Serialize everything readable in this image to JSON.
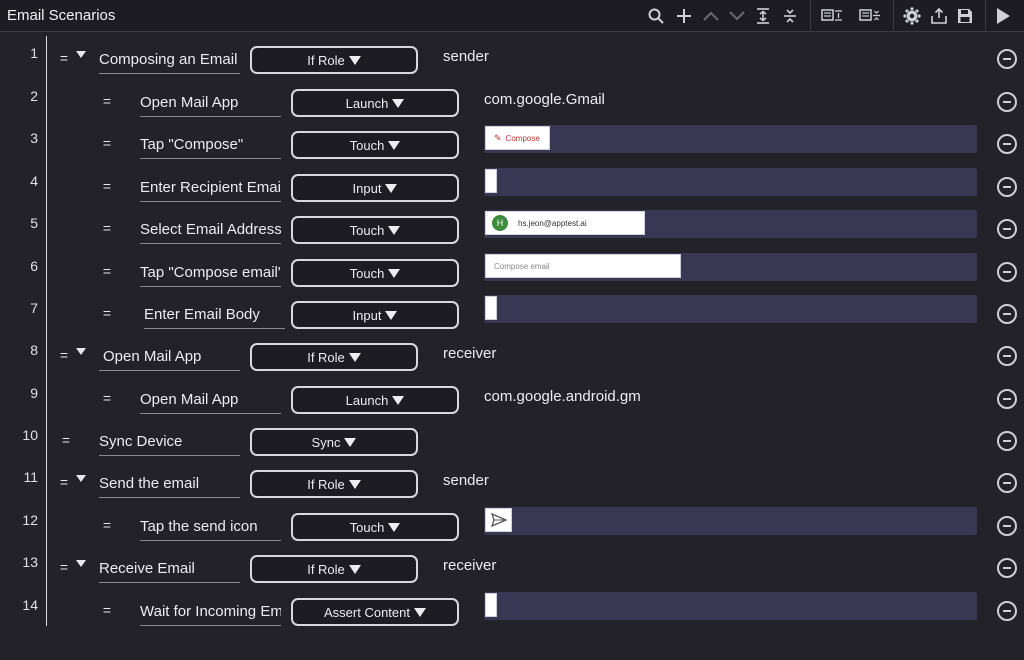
{
  "header": {
    "title": "Email Scenarios",
    "toolbar": [
      "search-icon",
      "add-icon",
      "move-up-icon",
      "move-down-icon",
      "expand-all-icon",
      "collapse-all-icon",
      "expand-text-icon",
      "collapse-text-icon",
      "settings-icon",
      "export-icon",
      "save-icon",
      "run-icon"
    ]
  },
  "steps": [
    {
      "no": "1",
      "name": "Composing an Email",
      "action": "If Role",
      "param": "sender",
      "level": 0,
      "group": true
    },
    {
      "no": "2",
      "name": "Open Mail App",
      "action": "Launch",
      "param": "com.google.Gmail",
      "level": 1
    },
    {
      "no": "3",
      "name": "Tap \"Compose\"",
      "action": "Touch",
      "thumb": "Compose",
      "level": 1
    },
    {
      "no": "4",
      "name": "Enter Recipient Email",
      "action": "Input",
      "thumb": "",
      "level": 1
    },
    {
      "no": "5",
      "name": "Select Email Address",
      "action": "Touch",
      "thumb": "hs.jeon@apptest.ai",
      "level": 1
    },
    {
      "no": "6",
      "name": "Tap \"Compose email\"",
      "action": "Touch",
      "thumb": "Compose email",
      "level": 1
    },
    {
      "no": "7",
      "name": "Enter Email Body",
      "action": "Input",
      "thumb": "",
      "level": 1
    },
    {
      "no": "8",
      "name": "Open Mail App",
      "action": "If Role",
      "param": "receiver",
      "level": 0,
      "group": true
    },
    {
      "no": "9",
      "name": "Open Mail App",
      "action": "Launch",
      "param": "com.google.android.gm",
      "level": 1
    },
    {
      "no": "10",
      "name": "Sync Device",
      "action": "Sync",
      "param": "",
      "level": 0,
      "group": false
    },
    {
      "no": "11",
      "name": "Send the email",
      "action": "If Role",
      "param": "sender",
      "level": 0,
      "group": true
    },
    {
      "no": "12",
      "name": "Tap the send icon",
      "action": "Touch",
      "thumb": "send-icon",
      "level": 1
    },
    {
      "no": "13",
      "name": "Receive Email",
      "action": "If Role",
      "param": "receiver",
      "level": 0,
      "group": true
    },
    {
      "no": "14",
      "name": "Wait for Incoming Email",
      "action": "Assert Content",
      "thumb": "",
      "level": 1
    }
  ]
}
